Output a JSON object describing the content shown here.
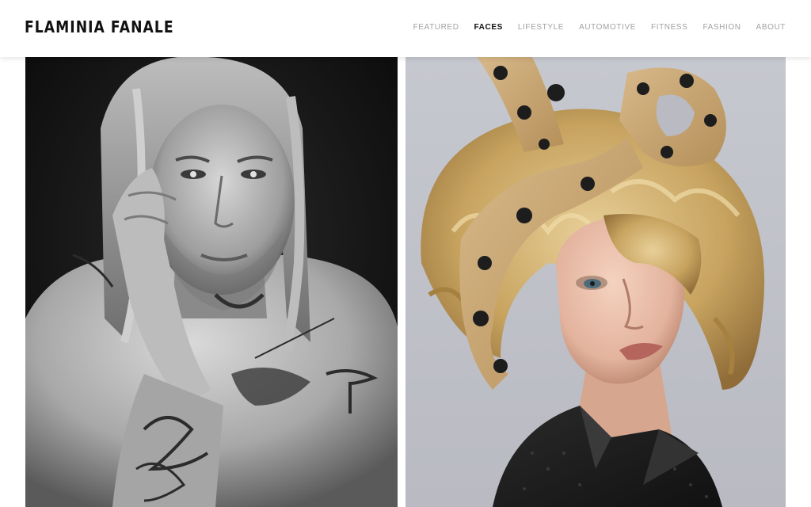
{
  "site": {
    "logo": "FLAMINIA FANALE"
  },
  "nav": {
    "items": [
      {
        "label": "FEATURED",
        "active": false
      },
      {
        "label": "FACES",
        "active": true
      },
      {
        "label": "LIFESTYLE",
        "active": false
      },
      {
        "label": "AUTOMOTIVE",
        "active": false
      },
      {
        "label": "FITNESS",
        "active": false
      },
      {
        "label": "FASHION",
        "active": false
      },
      {
        "label": "ABOUT",
        "active": false
      }
    ]
  },
  "colors": {
    "nav_inactive": "#a2a2a2",
    "nav_active": "#111111",
    "header_bg": "#ffffff"
  },
  "gallery": {
    "photos": [
      {
        "name": "bw-portrait-tattooed-man",
        "tone": "black-and-white"
      },
      {
        "name": "color-portrait-woman-polka-dot-headband",
        "tone": "color"
      }
    ]
  }
}
